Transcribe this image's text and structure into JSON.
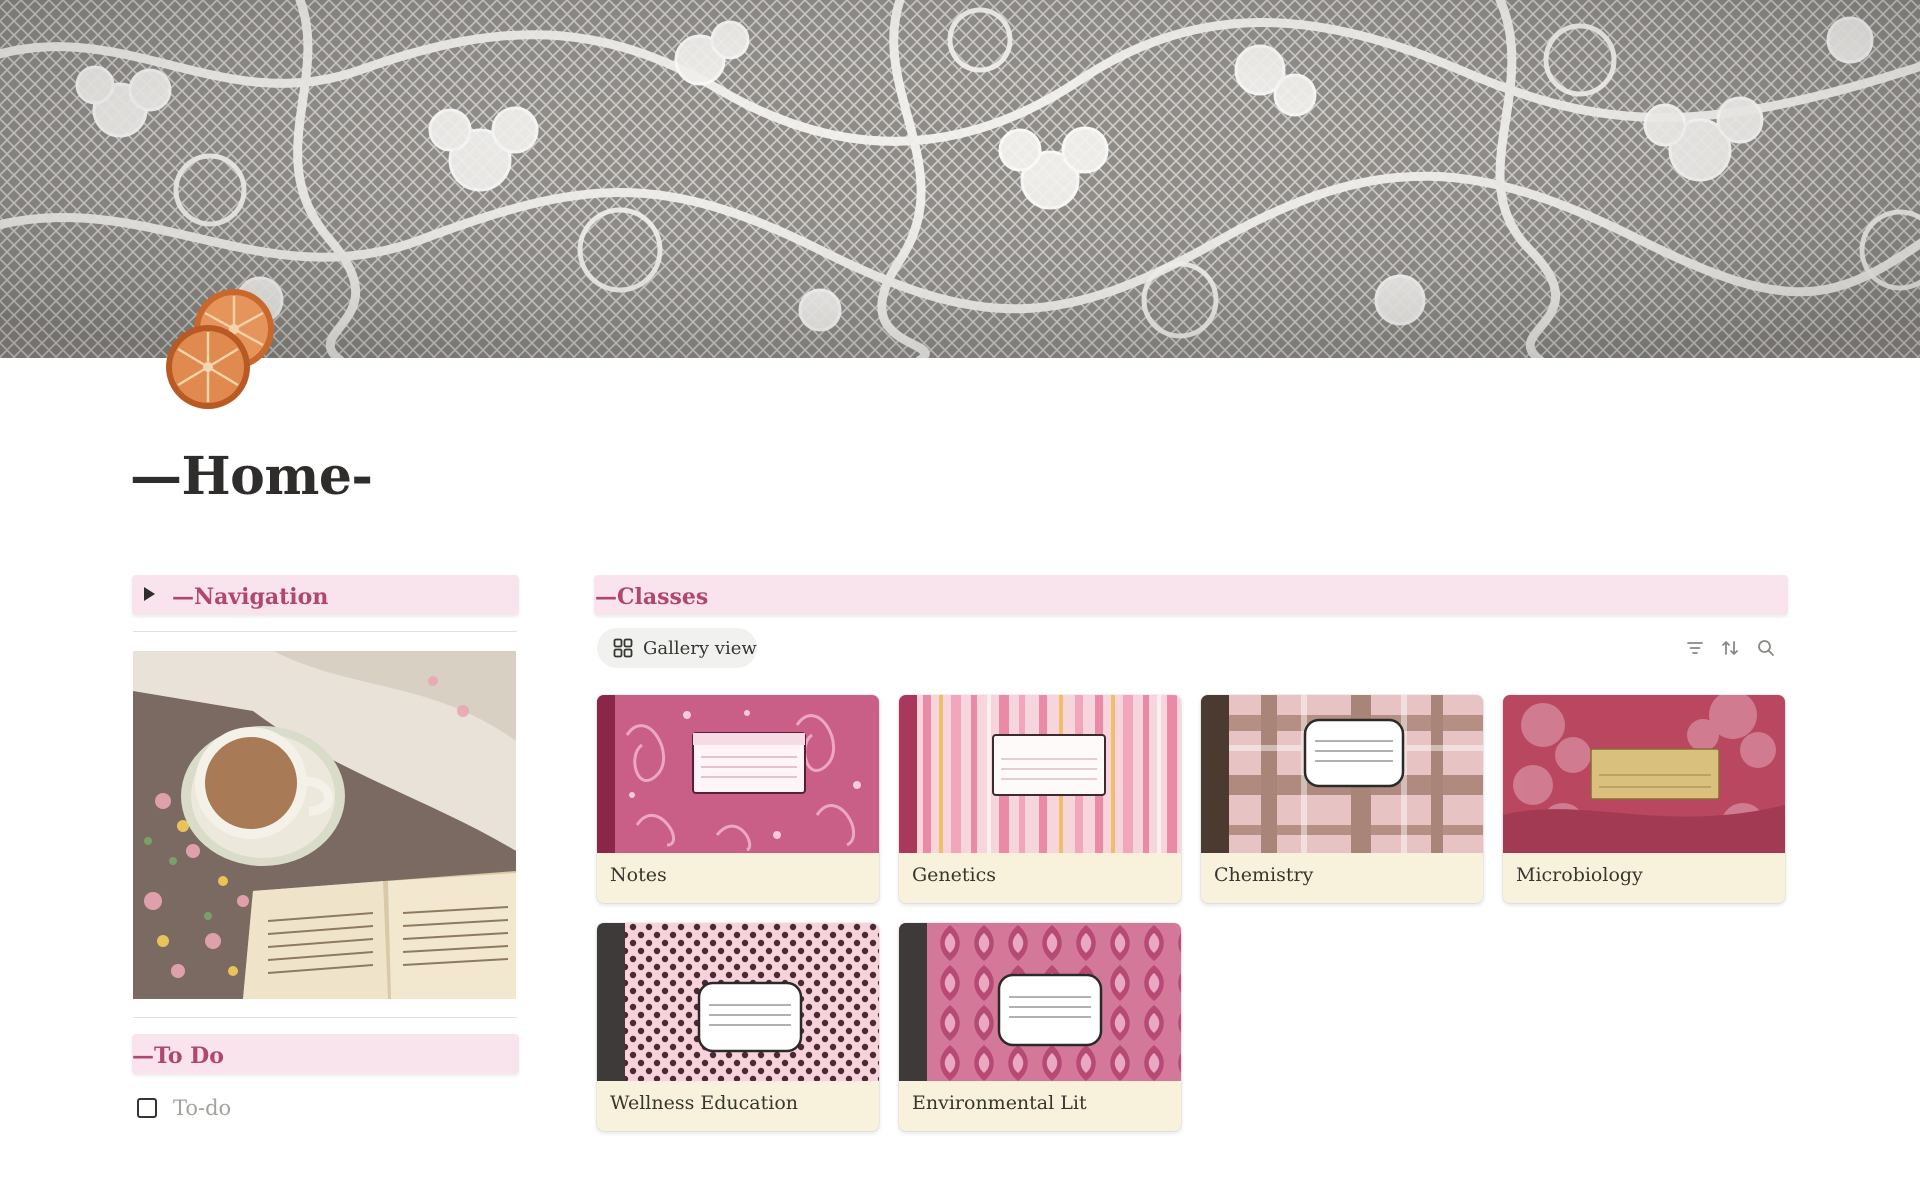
{
  "page": {
    "title": "—Home-"
  },
  "cover": {
    "description_icon": "lace-cover-image"
  },
  "icon": {
    "name": "dried-orange-slices-icon"
  },
  "navigation": {
    "heading": "—Navigation"
  },
  "todo": {
    "heading": "—To Do",
    "items": [
      {
        "placeholder": "To-do",
        "checked": false
      }
    ]
  },
  "classes": {
    "heading": "—Classes",
    "view_label": "Gallery view",
    "toolbar_icons": [
      "filter-icon",
      "sort-icon",
      "search-icon"
    ],
    "cards": [
      {
        "title": "Notes",
        "cover": "pink-swirl-composition-book"
      },
      {
        "title": "Genetics",
        "cover": "pink-stripe-composition-book"
      },
      {
        "title": "Chemistry",
        "cover": "plaid-composition-book"
      },
      {
        "title": "Microbiology",
        "cover": "floral-composition-notebook"
      },
      {
        "title": "Wellness Education",
        "cover": "polka-dot-composition-book"
      },
      {
        "title": "Environmental Lit",
        "cover": "damask-composition-book"
      }
    ]
  },
  "colors": {
    "heading_bg": "#f9e3ec",
    "heading_text": "#b0476f",
    "card_bg": "#f8f2dc"
  }
}
